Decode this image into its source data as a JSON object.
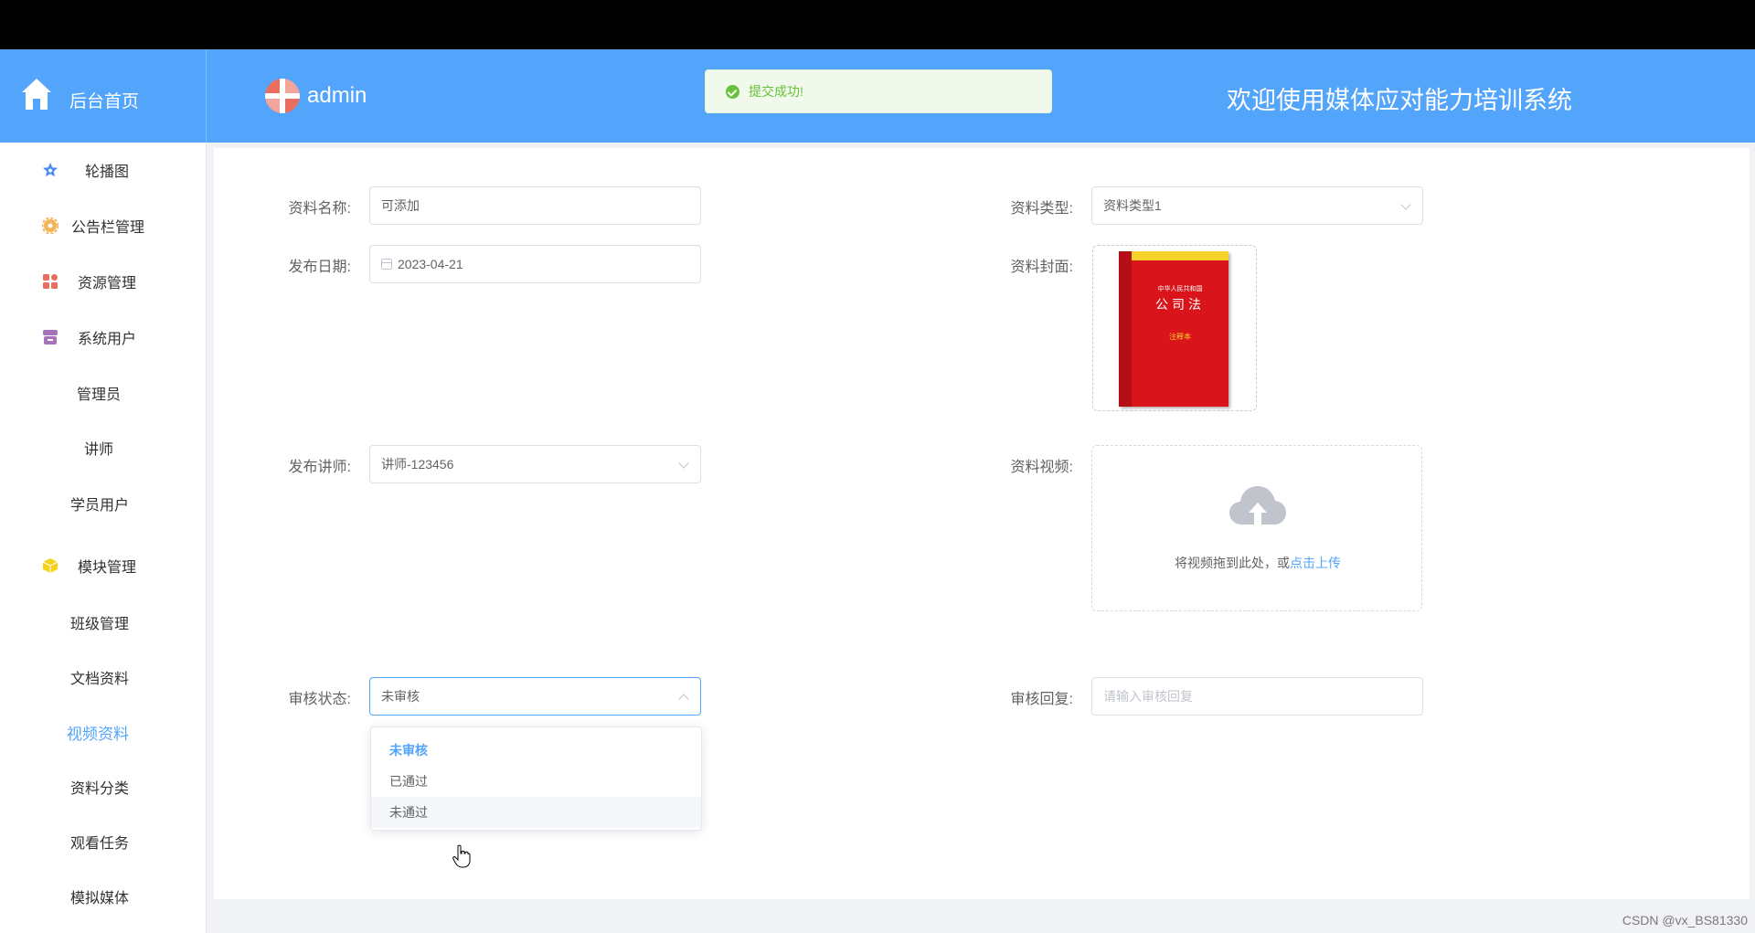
{
  "header": {
    "brand_label": "后台首页",
    "user_name": "admin",
    "toast_text": "提交成功!",
    "system_title": "欢迎使用媒体应对能力培训系统",
    "color": "#53a4fb"
  },
  "sidebar": {
    "items": [
      {
        "label": "轮播图",
        "icon": "star-icon"
      },
      {
        "label": "公告栏管理",
        "icon": "gear-icon"
      },
      {
        "label": "资源管理",
        "icon": "grid-icon"
      },
      {
        "label": "系统用户",
        "icon": "box-icon"
      },
      {
        "label": "管理员"
      },
      {
        "label": "讲师"
      },
      {
        "label": "学员用户"
      },
      {
        "label": "模块管理",
        "icon": "cube-icon"
      },
      {
        "label": "班级管理"
      },
      {
        "label": "文档资料"
      },
      {
        "label": "视频资料",
        "active": true
      },
      {
        "label": "资料分类"
      },
      {
        "label": "观看任务"
      },
      {
        "label": "模拟媒体"
      }
    ]
  },
  "form": {
    "name_label": "资料名称:",
    "name_value": "可添加",
    "type_label": "资料类型:",
    "type_value": "资料类型1",
    "date_label": "发布日期:",
    "date_value": "2023-04-21",
    "cover_label": "资料封面:",
    "cover_book": {
      "top_text": "中华人民共和国",
      "title": "公司法",
      "sub_text": "注释本"
    },
    "teacher_label": "发布讲师:",
    "teacher_value": "讲师-123456",
    "video_label": "资料视频:",
    "video_upload_text": "将视频拖到此处，或",
    "video_upload_link": "点击上传",
    "status_label": "审核状态:",
    "status_value": "未审核",
    "status_options": [
      "未审核",
      "已通过",
      "未通过"
    ],
    "reply_label": "审核回复:",
    "reply_placeholder": "请输入审核回复"
  },
  "watermark": "CSDN @vx_BS81330"
}
